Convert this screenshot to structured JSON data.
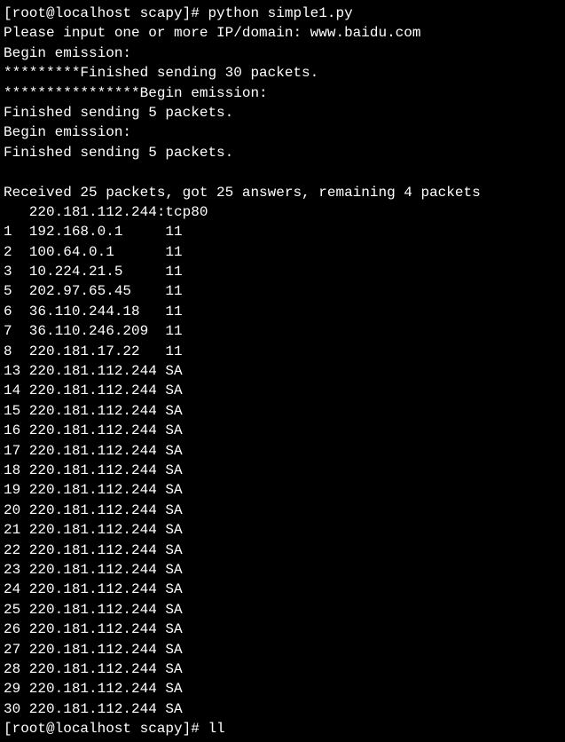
{
  "prompt1": "[root@localhost scapy]# ",
  "command1": "python simple1.py",
  "input_prompt": "Please input one or more IP/domain: ",
  "input_value": "www.baidu.com",
  "emission_lines": [
    "Begin emission:",
    "*********Finished sending 30 packets.",
    "****************Begin emission:",
    "Finished sending 5 packets.",
    "Begin emission:",
    "Finished sending 5 packets."
  ],
  "summary": "Received 25 packets, got 25 answers, remaining 4 packets",
  "header": "   220.181.112.244:tcp80",
  "rows": [
    {
      "n": "1 ",
      "ip": "192.168.0.1    ",
      "flag": "11"
    },
    {
      "n": "2 ",
      "ip": "100.64.0.1     ",
      "flag": "11"
    },
    {
      "n": "3 ",
      "ip": "10.224.21.5    ",
      "flag": "11"
    },
    {
      "n": "5 ",
      "ip": "202.97.65.45   ",
      "flag": "11"
    },
    {
      "n": "6 ",
      "ip": "36.110.244.18  ",
      "flag": "11"
    },
    {
      "n": "7 ",
      "ip": "36.110.246.209 ",
      "flag": "11"
    },
    {
      "n": "8 ",
      "ip": "220.181.17.22  ",
      "flag": "11"
    },
    {
      "n": "13",
      "ip": "220.181.112.244",
      "flag": "SA"
    },
    {
      "n": "14",
      "ip": "220.181.112.244",
      "flag": "SA"
    },
    {
      "n": "15",
      "ip": "220.181.112.244",
      "flag": "SA"
    },
    {
      "n": "16",
      "ip": "220.181.112.244",
      "flag": "SA"
    },
    {
      "n": "17",
      "ip": "220.181.112.244",
      "flag": "SA"
    },
    {
      "n": "18",
      "ip": "220.181.112.244",
      "flag": "SA"
    },
    {
      "n": "19",
      "ip": "220.181.112.244",
      "flag": "SA"
    },
    {
      "n": "20",
      "ip": "220.181.112.244",
      "flag": "SA"
    },
    {
      "n": "21",
      "ip": "220.181.112.244",
      "flag": "SA"
    },
    {
      "n": "22",
      "ip": "220.181.112.244",
      "flag": "SA"
    },
    {
      "n": "23",
      "ip": "220.181.112.244",
      "flag": "SA"
    },
    {
      "n": "24",
      "ip": "220.181.112.244",
      "flag": "SA"
    },
    {
      "n": "25",
      "ip": "220.181.112.244",
      "flag": "SA"
    },
    {
      "n": "26",
      "ip": "220.181.112.244",
      "flag": "SA"
    },
    {
      "n": "27",
      "ip": "220.181.112.244",
      "flag": "SA"
    },
    {
      "n": "28",
      "ip": "220.181.112.244",
      "flag": "SA"
    },
    {
      "n": "29",
      "ip": "220.181.112.244",
      "flag": "SA"
    },
    {
      "n": "30",
      "ip": "220.181.112.244",
      "flag": "SA"
    }
  ],
  "prompt2": "[root@localhost scapy]# ",
  "command2": "ll"
}
